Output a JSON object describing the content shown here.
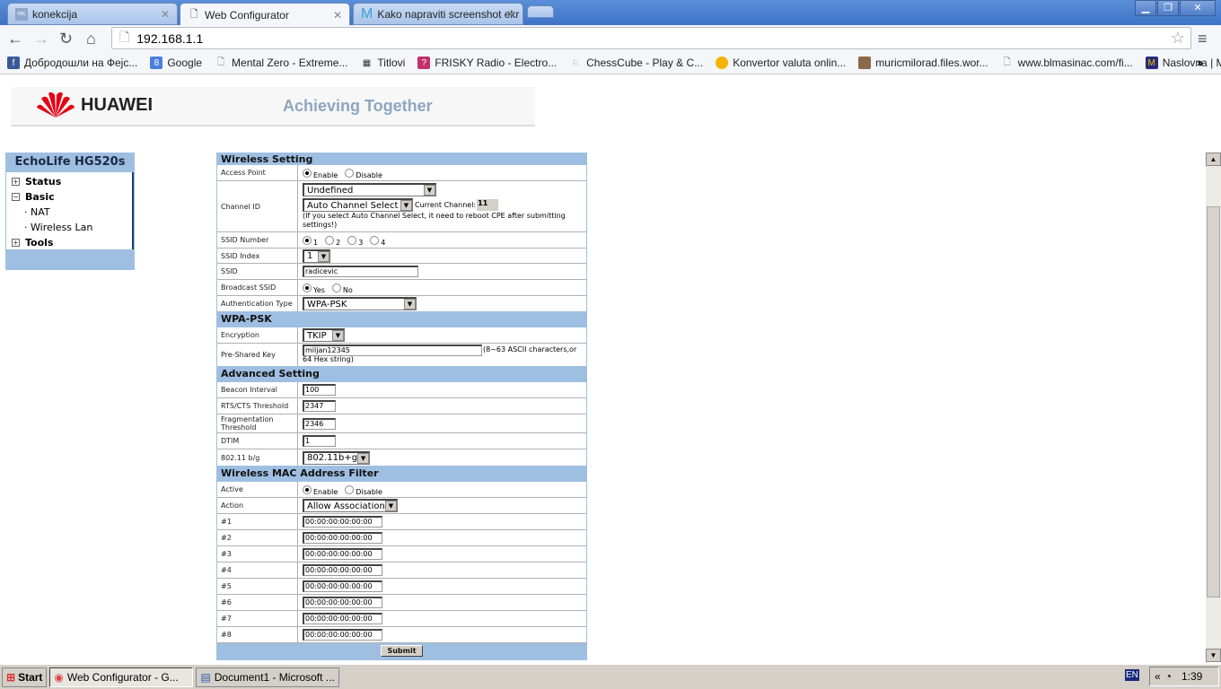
{
  "browser": {
    "tabs": [
      {
        "label": "konekcija",
        "icon": "mc-icon"
      },
      {
        "label": "Web Configurator",
        "icon": "page-icon"
      },
      {
        "label": "Kako napraviti screenshot ekr",
        "icon": "m-icon"
      }
    ],
    "url": "192.168.1.1",
    "bookmarks": [
      {
        "label": "Добродошли на Фејс...",
        "icon": "facebook-icon",
        "color": "#3b5998"
      },
      {
        "label": "Google",
        "icon": "google-icon",
        "color": "#4a7fe0"
      },
      {
        "label": "Mental Zero - Extreme...",
        "icon": "page-icon",
        "color": "#ffffff"
      },
      {
        "label": "Titlovi",
        "icon": "film-icon",
        "color": "#333333"
      },
      {
        "label": "FRISKY Radio - Electro...",
        "icon": "frisky-icon",
        "color": "#c0306a"
      },
      {
        "label": "ChessCube - Play & C...",
        "icon": "chess-icon",
        "color": "#999999"
      },
      {
        "label": "Konvertor valuta onlin...",
        "icon": "coin-icon",
        "color": "#f2b400"
      },
      {
        "label": "muricmilorad.files.wor...",
        "icon": "avatar-icon",
        "color": "#8a6a4a"
      },
      {
        "label": "www.blmasinac.com/fi...",
        "icon": "page-icon",
        "color": "#ffffff"
      },
      {
        "label": "Naslovna | Mozzart Bet",
        "icon": "mozzart-icon",
        "color": "#2a2a7a"
      }
    ],
    "more": "»"
  },
  "header": {
    "brand": "HUAWEI",
    "slogan": "Achieving Together"
  },
  "sidebar": {
    "title": "EchoLife HG520s",
    "items": [
      {
        "label": "Status",
        "expander": "+"
      },
      {
        "label": "Basic",
        "expander": "−"
      },
      {
        "label": "NAT"
      },
      {
        "label": "Wireless Lan"
      },
      {
        "label": "Tools",
        "expander": "+"
      }
    ]
  },
  "form": {
    "wireless": {
      "title": "Wireless Setting",
      "access_point": {
        "label": "Access Point",
        "opts": [
          "Enable",
          "Disable"
        ]
      },
      "channel": {
        "label": "Channel ID",
        "region": "Undefined",
        "mode": "Auto Channel Select",
        "current_label": "Current Channel:",
        "current": "11",
        "note": "(If you select Auto Channel Select, it need to reboot CPE after submitting settings!)"
      },
      "ssid_number": {
        "label": "SSID Number",
        "opts": [
          "1",
          "2",
          "3",
          "4"
        ]
      },
      "ssid_index": {
        "label": "SSID Index",
        "value": "1"
      },
      "ssid": {
        "label": "SSID",
        "value": "radicevic"
      },
      "broadcast": {
        "label": "Broadcast SSID",
        "opts": [
          "Yes",
          "No"
        ]
      },
      "auth": {
        "label": "Authentication Type",
        "value": "WPA-PSK"
      }
    },
    "wpa": {
      "title": "WPA-PSK",
      "encryption": {
        "label": "Encryption",
        "value": "TKIP"
      },
      "psk": {
        "label": "Pre-Shared Key",
        "value": "miljan12345",
        "hint": "(8~63 ASCII characters,or 64 Hex string)"
      }
    },
    "advanced": {
      "title": "Advanced Setting",
      "beacon": {
        "label": "Beacon Interval",
        "value": "100"
      },
      "rts": {
        "label": "RTS/CTS Threshold",
        "value": "2347"
      },
      "frag": {
        "label": "Fragmentation Threshold",
        "value": "2346"
      },
      "dtim": {
        "label": "DTIM",
        "value": "1"
      },
      "mode": {
        "label": "802.11 b/g",
        "value": "802.11b+g"
      }
    },
    "mac": {
      "title": "Wireless MAC Address Filter",
      "active": {
        "label": "Active",
        "opts": [
          "Enable",
          "Disable"
        ]
      },
      "action": {
        "label": "Action",
        "value": "Allow Association"
      },
      "entries": [
        {
          "label": "#1",
          "value": "00:00:00:00:00:00"
        },
        {
          "label": "#2",
          "value": "00:00:00:00:00:00"
        },
        {
          "label": "#3",
          "value": "00:00:00:00:00:00"
        },
        {
          "label": "#4",
          "value": "00:00:00:00:00:00"
        },
        {
          "label": "#5",
          "value": "00:00:00:00:00:00"
        },
        {
          "label": "#6",
          "value": "00:00:00:00:00:00"
        },
        {
          "label": "#7",
          "value": "00:00:00:00:00:00"
        },
        {
          "label": "#8",
          "value": "00:00:00:00:00:00"
        }
      ]
    },
    "submit": "Submit"
  },
  "taskbar": {
    "start": "Start",
    "items": [
      "Web Configurator - G...",
      "Document1 - Microsoft ..."
    ],
    "lang": "EN",
    "chevron": "«",
    "time": "1:39"
  }
}
